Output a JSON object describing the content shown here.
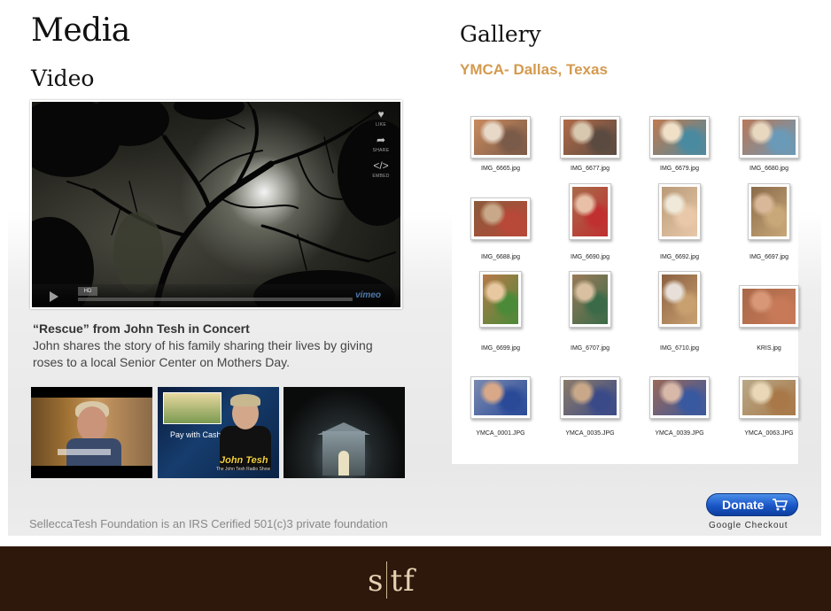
{
  "page": {
    "title": "Media"
  },
  "video_section": {
    "title": "Video",
    "player": {
      "side_icons": [
        {
          "icon": "heart-icon",
          "label": "LIKE"
        },
        {
          "icon": "share-icon",
          "label": "SHARE"
        },
        {
          "icon": "embed-icon",
          "label": "EMBED"
        }
      ],
      "hd_label": "HD",
      "brand": "vimeo"
    },
    "caption_title": "“Rescue” from John Tesh in Concert",
    "caption_desc": "John shares the story of his family sharing their lives by giving roses to a local Senior Center on Mothers Day.",
    "thumbnails": [
      {
        "name": "thumbnail-interview"
      },
      {
        "name": "thumbnail-radio-show",
        "inset_text": "Pay with Cash",
        "tag": "John Tesh",
        "tag_sub": "The John Tesh Radio Show"
      },
      {
        "name": "thumbnail-concert"
      }
    ]
  },
  "gallery": {
    "title": "Gallery",
    "subtitle": "YMCA- Dallas, Texas",
    "items": [
      {
        "filename": "IMG_6665.jpg",
        "orientation": "landscape",
        "colors": [
          "#c98a5e",
          "#e8d8c8",
          "#7a5a48"
        ]
      },
      {
        "filename": "IMG_6677.jpg",
        "orientation": "landscape",
        "colors": [
          "#b06a48",
          "#d8c8b0",
          "#5a4a40"
        ]
      },
      {
        "filename": "IMG_6679.jpg",
        "orientation": "landscape",
        "colors": [
          "#c07a50",
          "#f0e0c8",
          "#4a8aa0"
        ]
      },
      {
        "filename": "IMG_6680.jpg",
        "orientation": "landscape",
        "colors": [
          "#b87858",
          "#e8d8c0",
          "#6a9ab8"
        ]
      },
      {
        "filename": "IMG_6688.jpg",
        "orientation": "landscape",
        "colors": [
          "#8a5a3a",
          "#c8a888",
          "#b84838"
        ]
      },
      {
        "filename": "IMG_6690.jpg",
        "orientation": "portrait",
        "colors": [
          "#a86a4a",
          "#e8c0a8",
          "#c03030"
        ]
      },
      {
        "filename": "IMG_6692.jpg",
        "orientation": "portrait",
        "colors": [
          "#b89a78",
          "#f0e8d8",
          "#e8c8a8"
        ]
      },
      {
        "filename": "IMG_6697.jpg",
        "orientation": "portrait",
        "colors": [
          "#8a6a4a",
          "#d8b898",
          "#c8a878"
        ]
      },
      {
        "filename": "IMG_6699.jpg",
        "orientation": "portrait",
        "colors": [
          "#b87848",
          "#e8c8a0",
          "#4a8a38"
        ]
      },
      {
        "filename": "IMG_6707.jpg",
        "orientation": "portrait",
        "colors": [
          "#9a7a58",
          "#d8c0a0",
          "#3a6a48"
        ]
      },
      {
        "filename": "IMG_6710.jpg",
        "orientation": "portrait",
        "colors": [
          "#8a6040",
          "#e8e0d8",
          "#c8a070"
        ]
      },
      {
        "filename": "KRIS.jpg",
        "orientation": "landscape",
        "colors": [
          "#a86848",
          "#d89878",
          "#c87a58"
        ]
      },
      {
        "filename": "YMCA_0001.JPG",
        "orientation": "landscape",
        "colors": [
          "#7a8ab0",
          "#d8a888",
          "#2a4a98"
        ]
      },
      {
        "filename": "YMCA_0035.JPG",
        "orientation": "landscape",
        "colors": [
          "#8a7a68",
          "#c8a888",
          "#3a4a88"
        ]
      },
      {
        "filename": "YMCA_0039.JPG",
        "orientation": "landscape",
        "colors": [
          "#9a6858",
          "#d8b8a8",
          "#3858a0"
        ]
      },
      {
        "filename": "YMCA_0063.JPG",
        "orientation": "landscape",
        "colors": [
          "#b8a888",
          "#e8d8b8",
          "#a87848"
        ]
      }
    ]
  },
  "donate": {
    "label": "Donate",
    "provider": "Google Checkout",
    "color": "#1a56c8"
  },
  "footer": {
    "foundation_text": "SelleccaTesh Foundation is an IRS Cerified 501(c)3 private foundation",
    "logo_left": "s",
    "logo_right": "tf",
    "bg_color": "#2e170b"
  }
}
